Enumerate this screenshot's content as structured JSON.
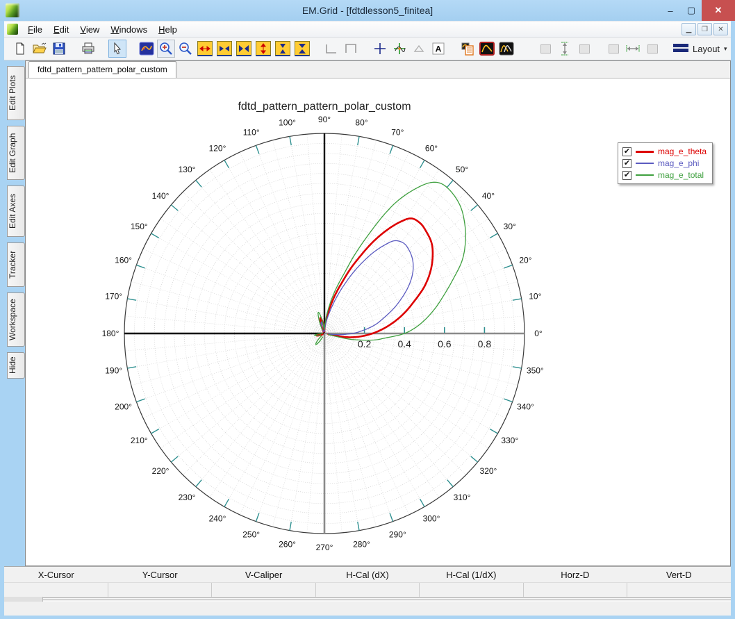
{
  "window": {
    "title": "EM.Grid - [fdtdlesson5_finitea]",
    "controls": {
      "minimize": "–",
      "maximize": "▢",
      "close": "✕"
    }
  },
  "menu": {
    "items": [
      "File",
      "Edit",
      "View",
      "Windows",
      "Help"
    ]
  },
  "toolbar": {
    "layout_label": "Layout",
    "caret": "▾"
  },
  "sidebar": {
    "tabs": [
      "Edit Plots",
      "Edit Graph",
      "Edit Axes",
      "Tracker",
      "Workspace",
      "Hide"
    ]
  },
  "tabbar": {
    "tabs": [
      "fdtd_pattern_pattern_polar_custom"
    ]
  },
  "chart_data": {
    "type": "polar-line",
    "title": "fdtd_pattern_pattern_polar_custom",
    "rmax": 1.0,
    "grid": {
      "circle_step": 0.05,
      "spoke_step_deg": 5,
      "angle_tick_step_deg": 10,
      "grid_on": true
    },
    "r_ticks": [
      0.2,
      0.4,
      0.6,
      0.8
    ],
    "r_tick_labels": [
      "0.2",
      "0.4",
      "0.6",
      "0.8"
    ],
    "angle_labels": [
      "0°",
      "10°",
      "20°",
      "30°",
      "40°",
      "50°",
      "60°",
      "70°",
      "80°",
      "90°",
      "100°",
      "110°",
      "120°",
      "130°",
      "140°",
      "150°",
      "160°",
      "170°",
      "180°",
      "190°",
      "200°",
      "210°",
      "220°",
      "230°",
      "240°",
      "250°",
      "260°",
      "270°",
      "280°",
      "290°",
      "300°",
      "310°",
      "320°",
      "330°",
      "340°",
      "350°"
    ],
    "legend": {
      "position": "top-right",
      "checkboxes": [
        true,
        true,
        true
      ]
    },
    "series": [
      {
        "name": "mag_e_theta",
        "color": "#dd0000",
        "width": 2.6,
        "lobes": [
          [
            [
              -12,
              0.02
            ],
            [
              -10,
              0.1
            ],
            [
              -7,
              0.15
            ],
            [
              -4,
              0.19
            ],
            [
              0,
              0.24
            ],
            [
              5,
              0.3
            ],
            [
              10,
              0.36
            ],
            [
              15,
              0.42
            ],
            [
              20,
              0.48
            ],
            [
              25,
              0.55
            ],
            [
              30,
              0.61
            ],
            [
              35,
              0.66
            ],
            [
              40,
              0.7
            ],
            [
              45,
              0.72
            ],
            [
              49,
              0.73
            ],
            [
              53,
              0.72
            ],
            [
              56,
              0.67
            ],
            [
              59,
              0.6
            ],
            [
              62,
              0.52
            ],
            [
              65,
              0.43
            ],
            [
              68,
              0.35
            ],
            [
              71,
              0.27
            ],
            [
              75,
              0.19
            ],
            [
              79,
              0.12
            ],
            [
              84,
              0.06
            ],
            [
              89,
              0.02
            ]
          ],
          [
            [
              92,
              0.01
            ],
            [
              98,
              0.05
            ],
            [
              104,
              0.08
            ],
            [
              110,
              0.05
            ],
            [
              116,
              0.01
            ]
          ],
          [
            [
              185,
              0.01
            ],
            [
              195,
              0.04
            ],
            [
              205,
              0.01
            ]
          ]
        ]
      },
      {
        "name": "mag_e_phi",
        "color": "#5b5bc0",
        "width": 1.3,
        "lobes": [
          [
            [
              -8,
              0.02
            ],
            [
              -5,
              0.07
            ],
            [
              -2,
              0.11
            ],
            [
              0,
              0.14
            ],
            [
              5,
              0.2
            ],
            [
              10,
              0.26
            ],
            [
              15,
              0.31
            ],
            [
              20,
              0.37
            ],
            [
              25,
              0.43
            ],
            [
              30,
              0.49
            ],
            [
              35,
              0.54
            ],
            [
              40,
              0.575
            ],
            [
              45,
              0.595
            ],
            [
              49,
              0.6
            ],
            [
              53,
              0.58
            ],
            [
              56,
              0.53
            ],
            [
              59,
              0.47
            ],
            [
              62,
              0.4
            ],
            [
              65,
              0.33
            ],
            [
              68,
              0.26
            ],
            [
              71,
              0.2
            ],
            [
              75,
              0.13
            ],
            [
              80,
              0.07
            ],
            [
              85,
              0.03
            ],
            [
              90,
              0.01
            ]
          ],
          [
            [
              93,
              0.01
            ],
            [
              99,
              0.04
            ],
            [
              105,
              0.06
            ],
            [
              111,
              0.04
            ],
            [
              117,
              0.01
            ]
          ]
        ]
      },
      {
        "name": "mag_e_total",
        "color": "#3fa03f",
        "width": 1.3,
        "lobes": [
          [
            [
              -15,
              0.02
            ],
            [
              -13,
              0.12
            ],
            [
              -10,
              0.19
            ],
            [
              -7,
              0.26
            ],
            [
              -4,
              0.31
            ],
            [
              0,
              0.4
            ],
            [
              4,
              0.46
            ],
            [
              8,
              0.51
            ],
            [
              13,
              0.57
            ],
            [
              18,
              0.63
            ],
            [
              23,
              0.7
            ],
            [
              28,
              0.78
            ],
            [
              33,
              0.84
            ],
            [
              38,
              0.89
            ],
            [
              43,
              0.93
            ],
            [
              48,
              0.95
            ],
            [
              52,
              0.95
            ],
            [
              55,
              0.92
            ],
            [
              58,
              0.85
            ],
            [
              61,
              0.76
            ],
            [
              63,
              0.68
            ],
            [
              66,
              0.54
            ],
            [
              69,
              0.42
            ],
            [
              72,
              0.31
            ],
            [
              76,
              0.22
            ],
            [
              80,
              0.14
            ],
            [
              84,
              0.08
            ],
            [
              88,
              0.04
            ],
            [
              92,
              0.02
            ]
          ],
          [
            [
              94,
              0.02
            ],
            [
              100,
              0.07
            ],
            [
              106,
              0.11
            ],
            [
              112,
              0.07
            ],
            [
              118,
              0.02
            ]
          ],
          [
            [
              180,
              0.01
            ],
            [
              190,
              0.05
            ],
            [
              200,
              0.02
            ]
          ],
          [
            [
              220,
              0.02
            ],
            [
              232,
              0.07
            ],
            [
              243,
              0.02
            ]
          ]
        ]
      }
    ]
  },
  "status_bar": {
    "columns": [
      {
        "label": "X-Cursor",
        "value": ""
      },
      {
        "label": "Y-Cursor",
        "value": ""
      },
      {
        "label": "V-Caliper",
        "value": ""
      },
      {
        "label": "H-Cal (dX)",
        "value": ""
      },
      {
        "label": "H-Cal (1/dX)",
        "value": ""
      },
      {
        "label": "Horz-D",
        "value": ""
      },
      {
        "label": "Vert-D",
        "value": ""
      }
    ]
  }
}
